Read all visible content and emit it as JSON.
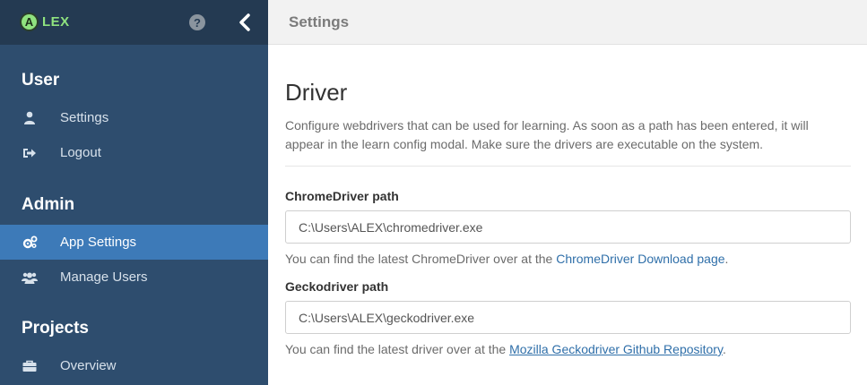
{
  "app": {
    "logo_letter": "A",
    "logo_text": "LEX",
    "help_symbol": "?"
  },
  "topbar": {
    "title": "Settings"
  },
  "sidebar": {
    "sections": [
      {
        "title": "User",
        "items": [
          {
            "label": "Settings",
            "icon": "user-icon"
          },
          {
            "label": "Logout",
            "icon": "sign-out-icon"
          }
        ]
      },
      {
        "title": "Admin",
        "items": [
          {
            "label": "App Settings",
            "icon": "cogs-icon",
            "active": true
          },
          {
            "label": "Manage Users",
            "icon": "users-icon"
          }
        ]
      },
      {
        "title": "Projects",
        "items": [
          {
            "label": "Overview",
            "icon": "briefcase-icon"
          }
        ]
      }
    ]
  },
  "main": {
    "heading": "Driver",
    "description": "Configure webdrivers that can be used for learning. As soon as a path has been entered, it will appear in the learn config modal. Make sure the drivers are executable on the system.",
    "chrome": {
      "label": "ChromeDriver path",
      "value": "C:\\Users\\ALEX\\chromedriver.exe",
      "help_prefix": "You can find the latest ChromeDriver over at the ",
      "link": "ChromeDriver Download page",
      "help_suffix": "."
    },
    "gecko": {
      "label": "Geckodriver path",
      "value": "C:\\Users\\ALEX\\geckodriver.exe",
      "help_prefix": "You can find the latest driver over at the ",
      "link": "Mozilla Geckodriver Github Repository",
      "help_suffix": "."
    }
  },
  "colors": {
    "sidebar_bg": "#2e4d6e",
    "sidebar_top_bg": "#243a52",
    "active_item": "#3d7ab8",
    "logo_green": "#8fe27f",
    "link": "#2f6fa9"
  }
}
